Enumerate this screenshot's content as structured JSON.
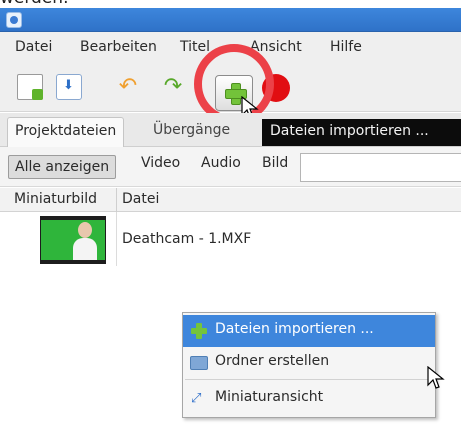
{
  "header": {
    "partial_text": "werden."
  },
  "menubar": {
    "items": [
      "Datei",
      "Bearbeiten",
      "Titel",
      "Ansicht",
      "Hilfe"
    ]
  },
  "tabs": {
    "project_files": "Projektdateien",
    "transitions": "Übergänge"
  },
  "tooltip": {
    "text": "Dateien importieren ..."
  },
  "filter": {
    "show_all": "Alle anzeigen",
    "video": "Video",
    "audio": "Audio",
    "image": "Bild"
  },
  "list": {
    "columns": [
      "Miniaturbild",
      "Datei"
    ],
    "rows": [
      {
        "file": "Deathcam - 1.MXF"
      }
    ]
  },
  "context_menu": {
    "items": [
      "Dateien importieren ...",
      "Ordner erstellen",
      "Miniaturansicht"
    ]
  },
  "colors": {
    "titlebar": "#3d86dc",
    "highlight": "#3e86dc",
    "annotation_ring": "#ec4148",
    "record": "#e10e12",
    "thumbnail_green": "#2fb53b"
  },
  "icons": [
    "new-file-icon",
    "save-icon",
    "undo-icon",
    "redo-icon",
    "add-file-icon",
    "record-icon",
    "folder-icon",
    "thumbnail-view-icon",
    "cursor-icon"
  ]
}
